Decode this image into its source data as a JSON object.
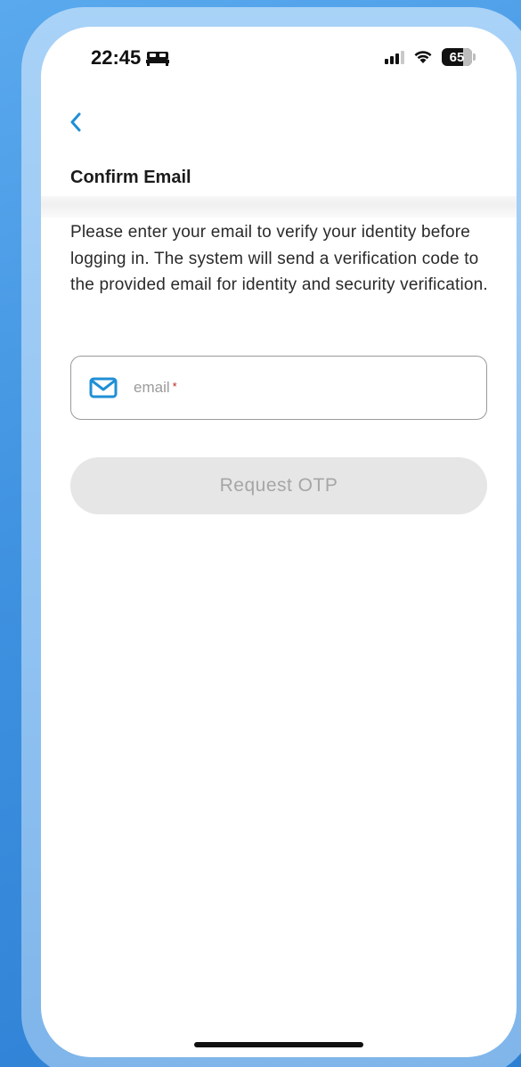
{
  "status_bar": {
    "time": "22:45",
    "battery_level": "65"
  },
  "header": {
    "back_icon": "chevron-left-icon",
    "title": "Confirm Email"
  },
  "content": {
    "description": "Please enter your email to verify your identity before logging in. The system will send a verification code to the provided email for identity and security verification.",
    "email_field": {
      "icon": "mail-icon",
      "placeholder": "email",
      "required_marker": "*",
      "value": ""
    },
    "request_button_label": "Request OTP"
  },
  "colors": {
    "accent": "#1f8fd6",
    "required": "#c0261f",
    "button_disabled_bg": "#e6e6e6",
    "button_disabled_text": "#a6a6a6"
  }
}
